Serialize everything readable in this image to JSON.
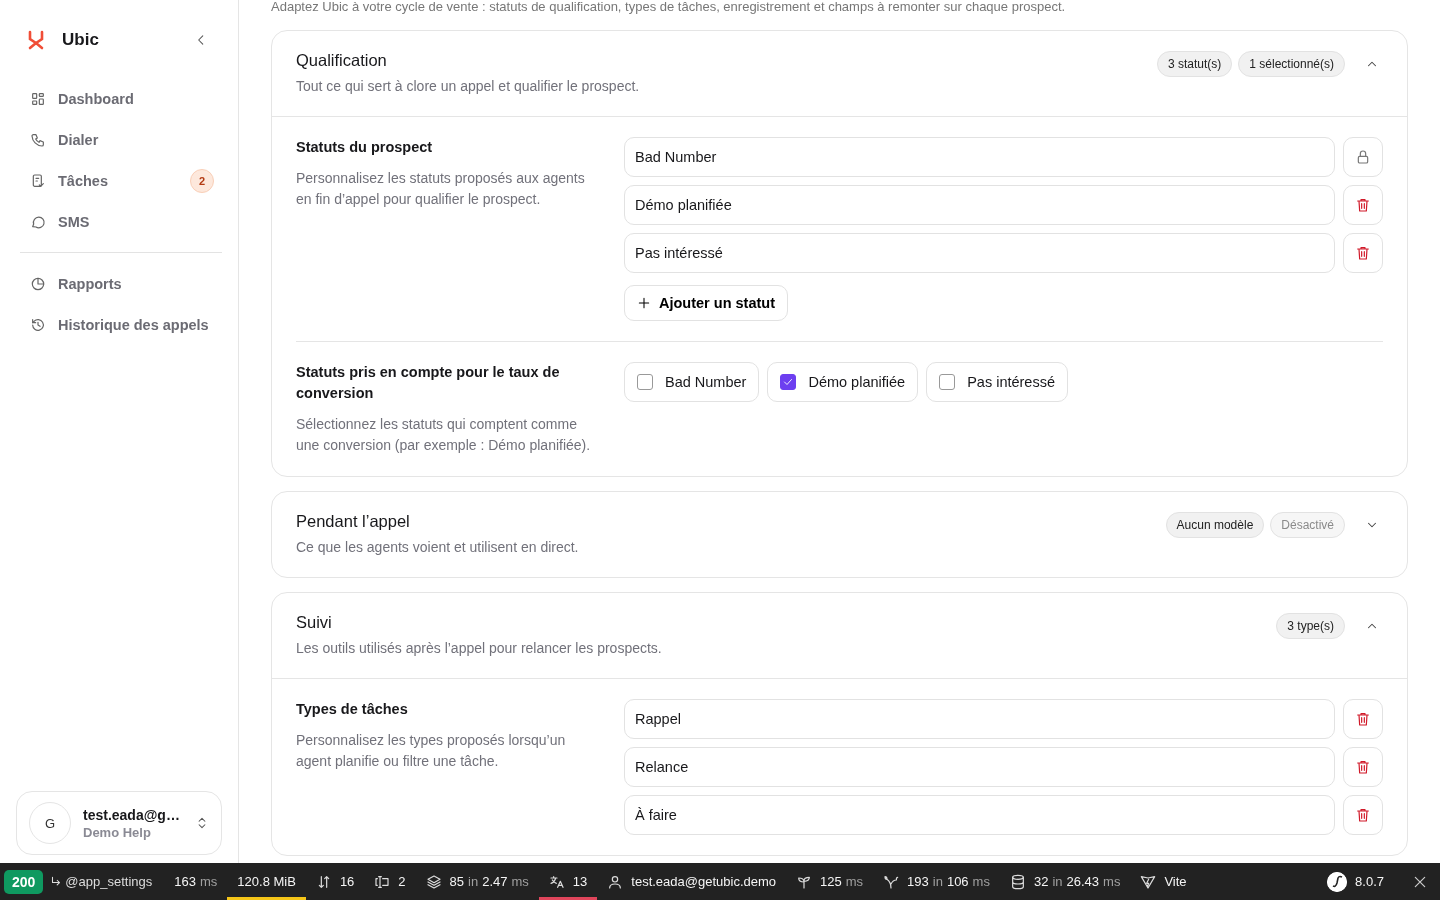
{
  "sidebar": {
    "brand": "Ubic",
    "groups": [
      [
        {
          "kind": "grid",
          "label": "Dashboard",
          "selected": false
        },
        {
          "kind": "phone",
          "label": "Dialer",
          "selected": false
        },
        {
          "kind": "task",
          "label": "Tâches",
          "badge": "2",
          "selected": false
        },
        {
          "kind": "chat",
          "label": "SMS",
          "selected": false
        }
      ],
      [
        {
          "kind": "pie",
          "label": "Rapports",
          "selected": false
        },
        {
          "kind": "history",
          "label": "Historique des appels",
          "selected": false
        }
      ]
    ],
    "user": {
      "initial": "G",
      "email": "test.eada@g…",
      "org": "Demo Help"
    }
  },
  "intro": "Adaptez Ubic à votre cycle de vente : statuts de qualification, types de tâches, enregistrement et champs à remonter sur chaque prospect.",
  "cards": [
    {
      "title": "Qualification",
      "subtitle": "Tout ce qui sert à clore un appel et qualifier le prospect.",
      "expanded": true,
      "badges": [
        {
          "text": "3 statut(s)",
          "disabled": false
        },
        {
          "text": "1 sélectionné(s)",
          "disabled": false
        }
      ],
      "sections": [
        {
          "kind": "list",
          "title": "Statuts du prospect",
          "description": "Personnalisez les statuts proposés aux agents en fin d’appel pour qualifier le prospect.",
          "rows": [
            {
              "value": "Bad Number",
              "locked": true
            },
            {
              "value": "Démo planifiée",
              "locked": false
            },
            {
              "value": "Pas intéressé",
              "locked": false
            }
          ],
          "add_label": "Ajouter un statut"
        },
        {
          "kind": "checks",
          "title": "Statuts pris en compte pour le taux de conversion",
          "description": "Sélectionnez les statuts qui comptent comme une conversion (par exemple : Démo planifiée).",
          "options": [
            {
              "label": "Bad Number",
              "selected": false
            },
            {
              "label": "Démo planifiée",
              "selected": true
            },
            {
              "label": "Pas intéressé",
              "selected": false
            }
          ]
        }
      ]
    },
    {
      "title": "Pendant l’appel",
      "subtitle": "Ce que les agents voient et utilisent en direct.",
      "expanded": false,
      "badges": [
        {
          "text": "Aucun modèle",
          "disabled": false
        },
        {
          "text": "Désactivé",
          "disabled": true
        }
      ]
    },
    {
      "title": "Suivi",
      "subtitle": "Les outils utilisés après l’appel pour relancer les prospects.",
      "expanded": true,
      "badges": [
        {
          "text": "3 type(s)",
          "disabled": false
        }
      ],
      "sections": [
        {
          "kind": "list",
          "title": "Types de tâches",
          "description": "Personnalisez les types proposés lorsqu’un agent planifie ou filtre une tâche.",
          "rows": [
            {
              "value": "Rappel",
              "locked": false
            },
            {
              "value": "Relance",
              "locked": false
            },
            {
              "value": "À faire",
              "locked": false
            }
          ]
        }
      ]
    }
  ],
  "toolbar": {
    "status": "200",
    "route": "@app_settings",
    "items": [
      {
        "value": "163",
        "unit": "ms"
      },
      {
        "value": "120.8 MiB",
        "color": "#f5c518"
      },
      {
        "kind": "arrows",
        "value": "16"
      },
      {
        "kind": "form",
        "value": "2"
      },
      {
        "kind": "layers",
        "value": "85",
        "connector": "in",
        "value2": "2.47",
        "unit": "ms"
      },
      {
        "kind": "translate",
        "value": "13",
        "color": "#e0455b"
      },
      {
        "kind": "user",
        "value": "test.eada@getubic.demo"
      },
      {
        "kind": "sprout",
        "value": "125",
        "unit": "ms"
      },
      {
        "kind": "twig",
        "value": "193",
        "connector": "in",
        "value2": "106",
        "unit": "ms"
      },
      {
        "kind": "database",
        "value": "32",
        "connector": "in",
        "value2": "26.43",
        "unit": "ms"
      },
      {
        "kind": "vite",
        "value": "Vite"
      }
    ],
    "version": "8.0.7"
  }
}
